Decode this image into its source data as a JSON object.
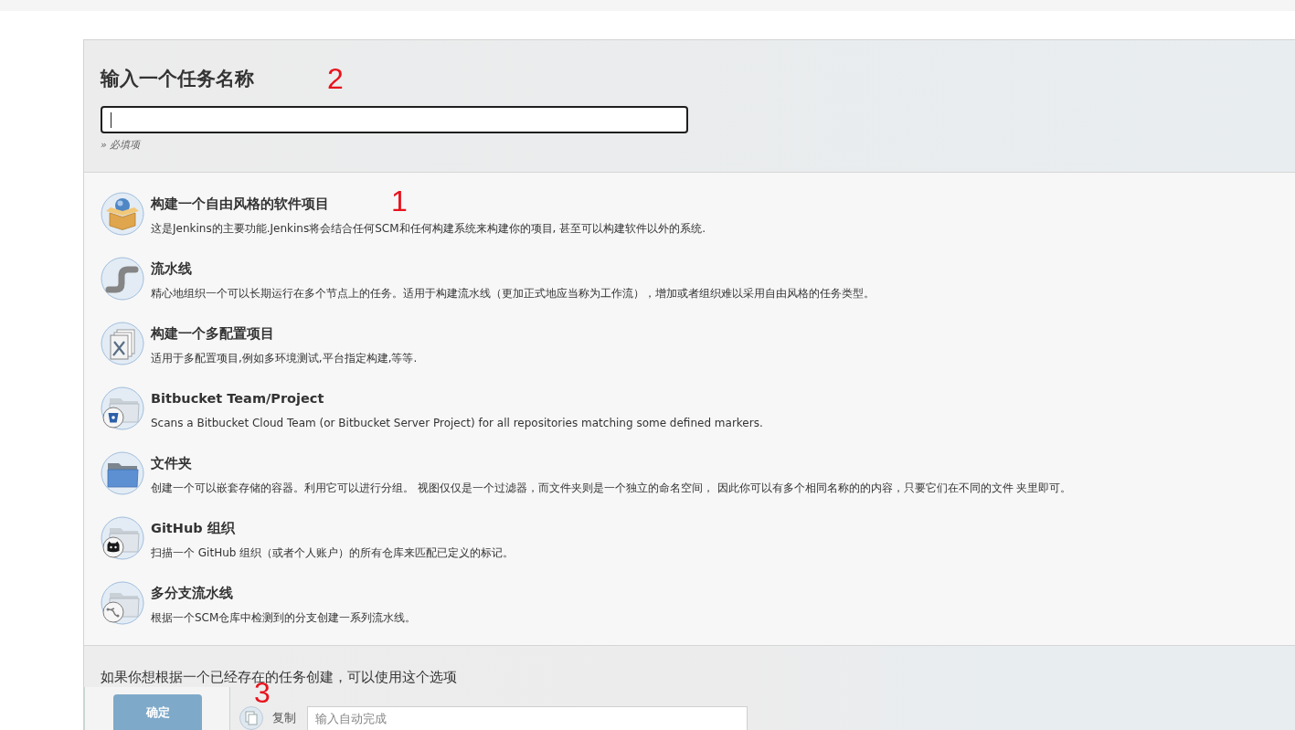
{
  "header": {
    "title": "输入一个任务名称",
    "annotation": "2",
    "name_field": {
      "focused": true
    },
    "hint": "» 必填项"
  },
  "item_types": [
    {
      "kind": "freestyle",
      "selected": false,
      "title": "构建一个自由风格的软件项目",
      "annotation": "1",
      "description": "这是Jenkins的主要功能.Jenkins将会结合任何SCM和任何构建系统来构建你的项目, 甚至可以构建软件以外的系统."
    },
    {
      "kind": "pipeline",
      "selected": false,
      "title": "流水线",
      "description": "精心地组织一个可以长期运行在多个节点上的任务。适用于构建流水线（更加正式地应当称为工作流），增加或者组织难以采用自由风格的任务类型。"
    },
    {
      "kind": "matrix",
      "selected": false,
      "title": "构建一个多配置项目",
      "description": "适用于多配置项目,例如多环境测试,平台指定构建,等等."
    },
    {
      "kind": "bitbucket",
      "selected": false,
      "title": "Bitbucket Team/Project",
      "description": "Scans a Bitbucket Cloud Team (or Bitbucket Server Project) for all repositories matching some defined markers."
    },
    {
      "kind": "folder",
      "selected": false,
      "title": "文件夹",
      "description": "创建一个可以嵌套存储的容器。利用它可以进行分组。 视图仅仅是一个过滤器，而文件夹则是一个独立的命名空间， 因此你可以有多个相同名称的的内容，只要它们在不同的文件 夹里即可。"
    },
    {
      "kind": "github",
      "selected": false,
      "title": "GitHub 组织",
      "description": "扫描一个 GitHub 组织（或者个人账户）的所有仓库来匹配已定义的标记。"
    },
    {
      "kind": "multibranch",
      "selected": false,
      "title": "多分支流水线",
      "description": "根据一个SCM仓库中检测到的分支创建一系列流水线。"
    }
  ],
  "copy_section": {
    "text": "如果你想根据一个已经存在的任务创建，可以使用这个选项",
    "annotation": "3",
    "label": "复制",
    "field": {
      "placeholder": "输入自动完成"
    }
  },
  "footer": {
    "button": "确定"
  }
}
